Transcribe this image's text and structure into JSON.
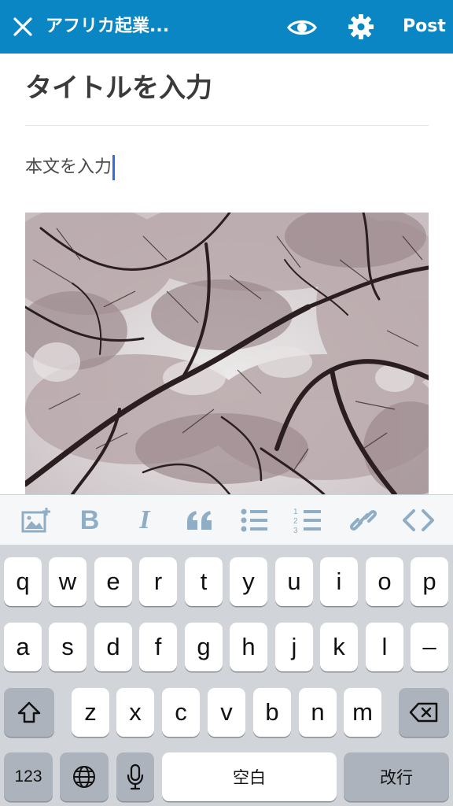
{
  "topbar": {
    "site_title": "アフリカ起業...",
    "post_label": "Post",
    "icons": [
      "close-icon",
      "eye-icon",
      "gear-icon"
    ]
  },
  "editor": {
    "title_placeholder": "タイトルを入力",
    "body_placeholder": "本文を入力"
  },
  "format_toolbar": {
    "icons": [
      "add-media-icon",
      "bold-icon",
      "italic-icon",
      "quote-icon",
      "bullet-list-icon",
      "numbered-list-icon",
      "link-icon",
      "html-mode-icon"
    ],
    "bold_glyph": "B",
    "italic_glyph": "I",
    "numbers": [
      "1",
      "2",
      "3"
    ]
  },
  "keyboard": {
    "row1": [
      "q",
      "w",
      "e",
      "r",
      "t",
      "y",
      "u",
      "i",
      "o",
      "p"
    ],
    "row2": [
      "a",
      "s",
      "d",
      "f",
      "g",
      "h",
      "j",
      "k",
      "l",
      "–"
    ],
    "row3": [
      "z",
      "x",
      "c",
      "v",
      "b",
      "n",
      "m"
    ],
    "numbers_key": "123",
    "space_key": "空白",
    "return_key": "改行",
    "icons": [
      "shift-icon",
      "backspace-icon",
      "globe-icon",
      "microphone-icon"
    ]
  },
  "colors": {
    "topbar": "#0a86c4",
    "caret": "#2d6fe0",
    "toolbar_icon": "#8fadc4"
  }
}
